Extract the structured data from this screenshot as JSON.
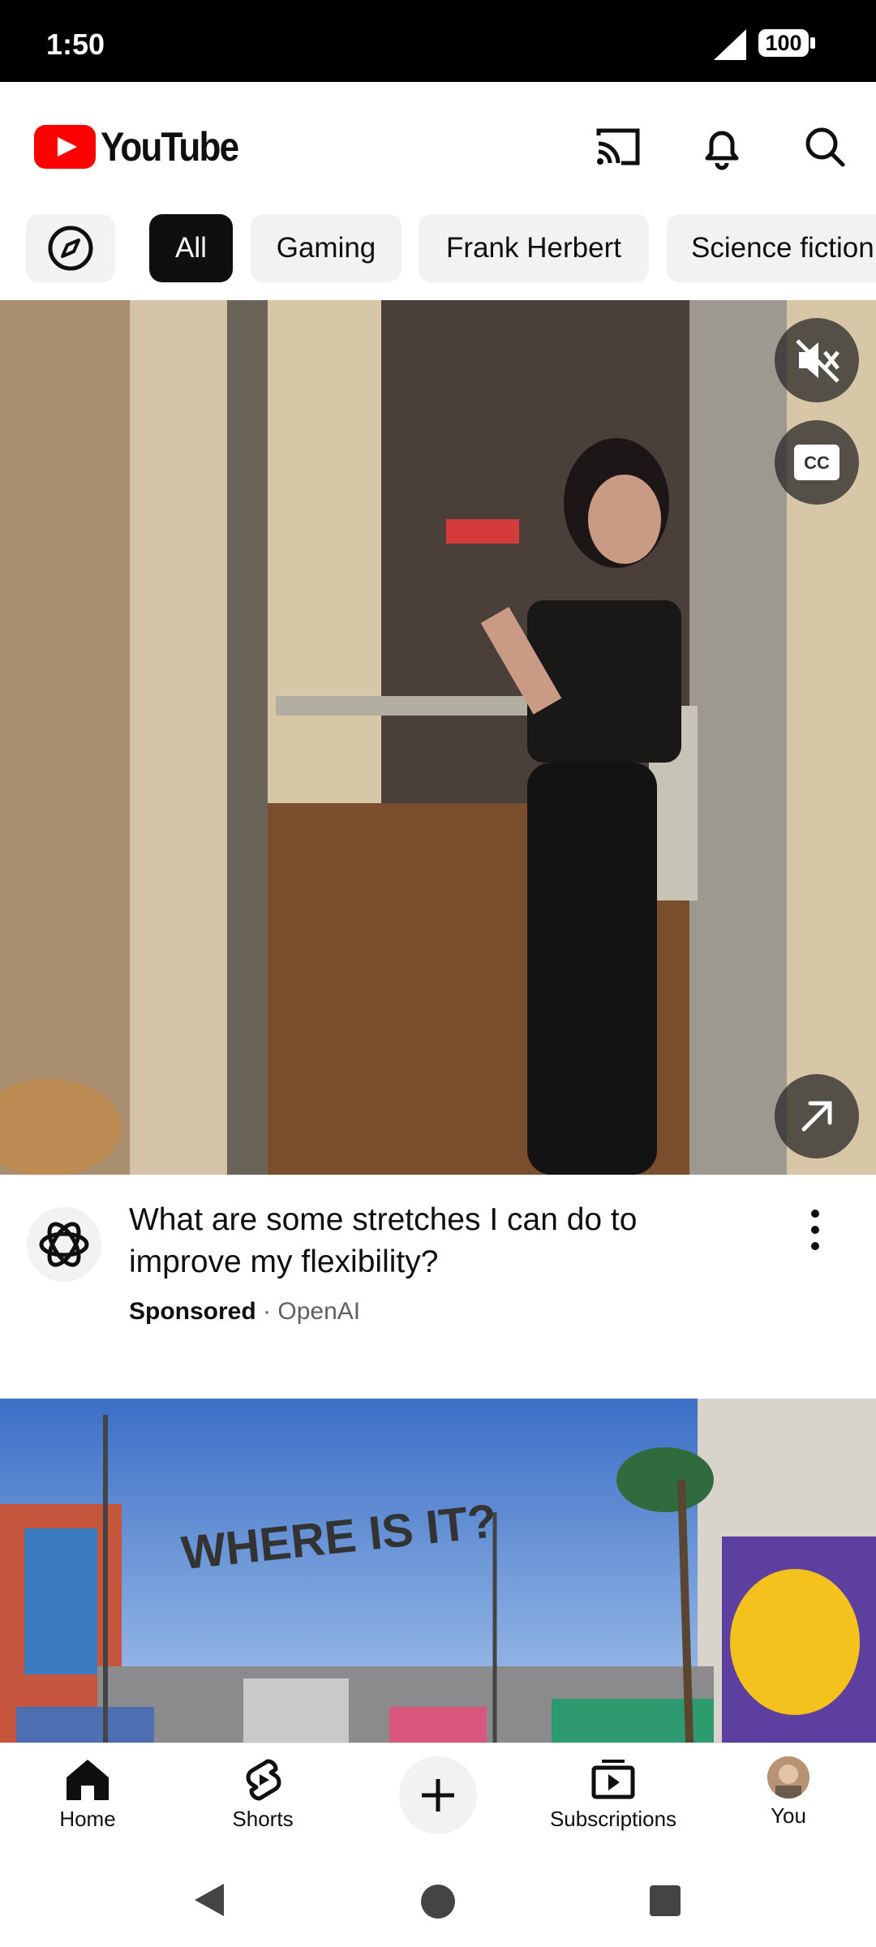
{
  "status_bar": {
    "time": "1:50",
    "battery": "100"
  },
  "header": {
    "logo_text": "YouTube"
  },
  "chips": [
    {
      "label": "All"
    },
    {
      "label": "Gaming"
    },
    {
      "label": "Frank Herbert"
    },
    {
      "label": "Science fiction"
    }
  ],
  "video1": {
    "title": "What are some stretches I can do to improve my flexibility?",
    "sponsored_label": "Sponsored",
    "separator": "·",
    "channel": "OpenAI"
  },
  "video2": {
    "overlay_text": "WHERE IS IT?"
  },
  "bottom_nav": {
    "home": "Home",
    "shorts": "Shorts",
    "subscriptions": "Subscriptions",
    "you": "You"
  },
  "colors": {
    "brand_red": "#ff0000",
    "chip_active_bg": "#0f0f0f",
    "chip_bg": "#f2f2f2"
  }
}
